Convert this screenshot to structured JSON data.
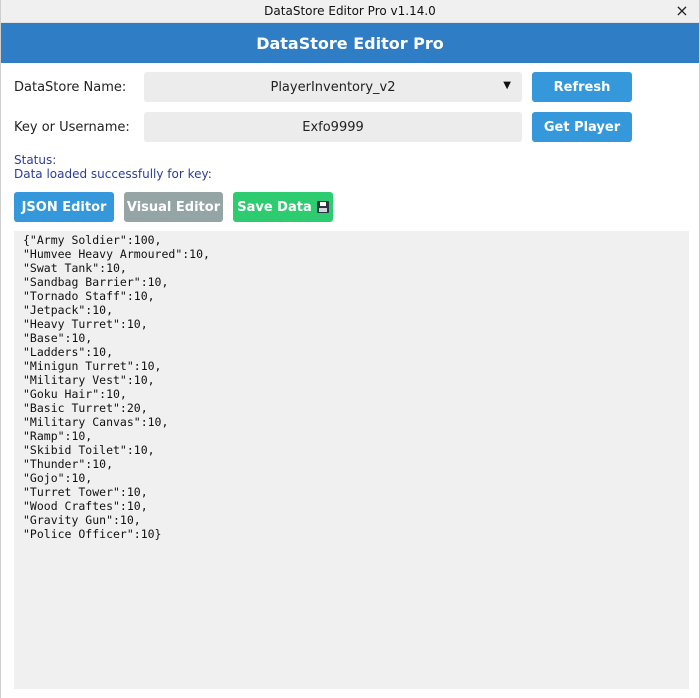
{
  "window": {
    "title": "DataStore Editor Pro v1.14.0",
    "close_glyph": "×"
  },
  "header": {
    "title": "DataStore Editor Pro"
  },
  "datastore": {
    "label": "DataStore Name:",
    "value": "PlayerInventory_v2",
    "arrow": "▼",
    "refresh_label": "Refresh"
  },
  "key": {
    "label": "Key or Username:",
    "value": "Exfo9999",
    "get_player_label": "Get Player"
  },
  "status": {
    "label": "Status:",
    "message": "Data loaded successfully for key:"
  },
  "toolbar": {
    "json_label": "JSON Editor",
    "visual_label": "Visual Editor",
    "save_label": "Save Data",
    "save_icon": "floppy-disk-icon"
  },
  "editor": {
    "content": "{\"Army Soldier\":100,\n\"Humvee Heavy Armoured\":10,\n\"Swat Tank\":10,\n\"Sandbag Barrier\":10,\n\"Tornado Staff\":10,\n\"Jetpack\":10,\n\"Heavy Turret\":10,\n\"Base\":10,\n\"Ladders\":10,\n\"Minigun Turret\":10,\n\"Military Vest\":10,\n\"Goku Hair\":10,\n\"Basic Turret\":20,\n\"Military Canvas\":10,\n\"Ramp\":10,\n\"Skibid Toilet\":10,\n\"Thunder\":10,\n\"Gojo\":10,\n\"Turret Tower\":10,\n\"Wood Craftes\":10,\n\"Gravity Gun\":10,\n\"Police Officer\":10}"
  },
  "colors": {
    "header_bg": "#2f7dc4",
    "primary_button": "#3498db",
    "secondary_button": "#95a5a6",
    "success_button": "#2ecc71",
    "status_text": "#2c3e95",
    "field_bg": "#ececec",
    "editor_bg": "#f0f0f0"
  }
}
